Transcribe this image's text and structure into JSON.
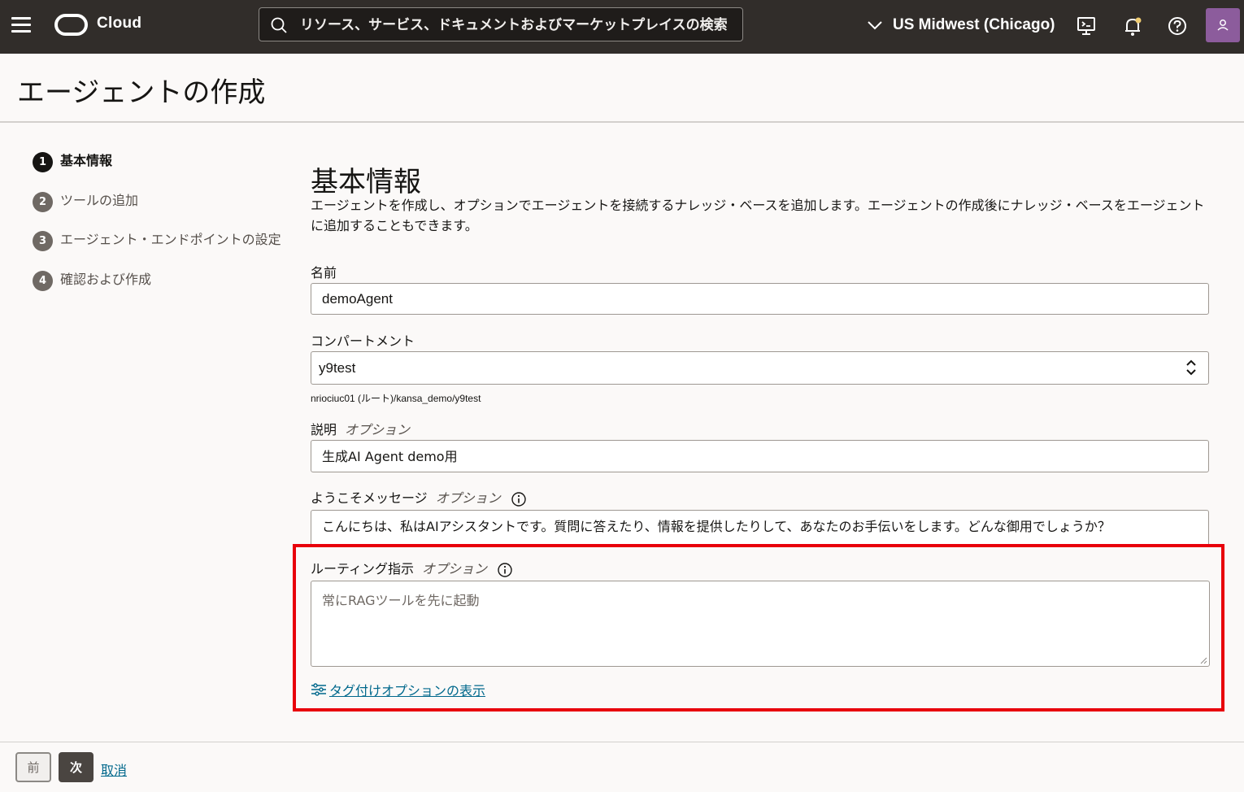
{
  "topbar": {
    "brand": "Cloud",
    "search_placeholder": "リソース、サービス、ドキュメントおよびマーケットプレイスの検索",
    "region": "US Midwest (Chicago)"
  },
  "page": {
    "title": "エージェントの作成"
  },
  "steps": [
    {
      "num": "1",
      "label": "基本情報"
    },
    {
      "num": "2",
      "label": "ツールの追加"
    },
    {
      "num": "3",
      "label": "エージェント・エンドポイントの設定"
    },
    {
      "num": "4",
      "label": "確認および作成"
    }
  ],
  "form": {
    "section_title": "基本情報",
    "section_desc": "エージェントを作成し、オプションでエージェントを接続するナレッジ・ベースを追加します。エージェントの作成後にナレッジ・ベースをエージェントに追加することもできます。",
    "name_label": "名前",
    "name_value": "demoAgent",
    "compartment_label": "コンパートメント",
    "compartment_value": "y9test",
    "compartment_path": "nriociuc01 (ルート)/kansa_demo/y9test",
    "desc_label": "説明",
    "optional": "オプション",
    "desc_value": "生成AI Agent demo用",
    "welcome_label": "ようこそメッセージ",
    "welcome_value": "こんにちは、私はAIアシスタントです。質問に答えたり、情報を提供したりして、あなたのお手伝いをします。どんな御用でしょうか？",
    "routing_label": "ルーティング指示",
    "routing_placeholder": "常にRAGツールを先に起動",
    "tag_link": "タグ付けオプションの表示"
  },
  "footer": {
    "prev": "前",
    "next": "次",
    "cancel": "取消"
  },
  "colors": {
    "topbar": "#312d2a",
    "link": "#00688c",
    "highlight": "#e8000b"
  }
}
